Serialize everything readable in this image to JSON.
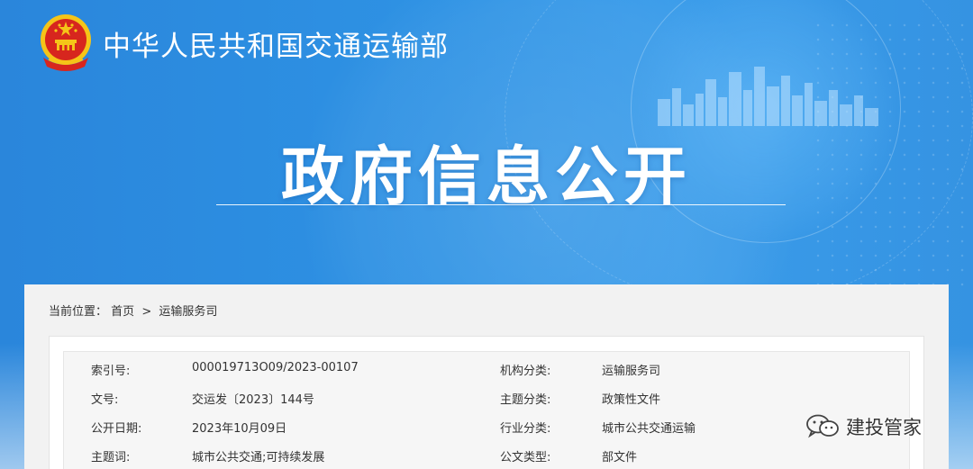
{
  "header": {
    "ministry_name": "中华人民共和国交通运输部",
    "page_title": "政府信息公开"
  },
  "breadcrumb": {
    "prefix": "当前位置：",
    "items": [
      "首页",
      "运输服务司"
    ],
    "separator": ">"
  },
  "info": {
    "rows": [
      {
        "label1": "索引号:",
        "value1": "000019713O09/2023-00107",
        "label2": "机构分类:",
        "value2": "运输服务司"
      },
      {
        "label1": "文号:",
        "value1": "交运发〔2023〕144号",
        "label2": "主题分类:",
        "value2": "政策性文件"
      },
      {
        "label1": "公开日期:",
        "value1": "2023年10月09日",
        "label2": "行业分类:",
        "value2": "城市公共交通运输"
      },
      {
        "label1": "主题词:",
        "value1": "城市公共交通;可持续发展",
        "label2": "公文类型:",
        "value2": "部文件"
      }
    ]
  },
  "watermark": {
    "text": "建投管家",
    "icon": "wechat-icon"
  },
  "colors": {
    "banner_blue": "#2e8fe0",
    "emblem_red": "#d7261e",
    "emblem_gold": "#f5c518"
  }
}
